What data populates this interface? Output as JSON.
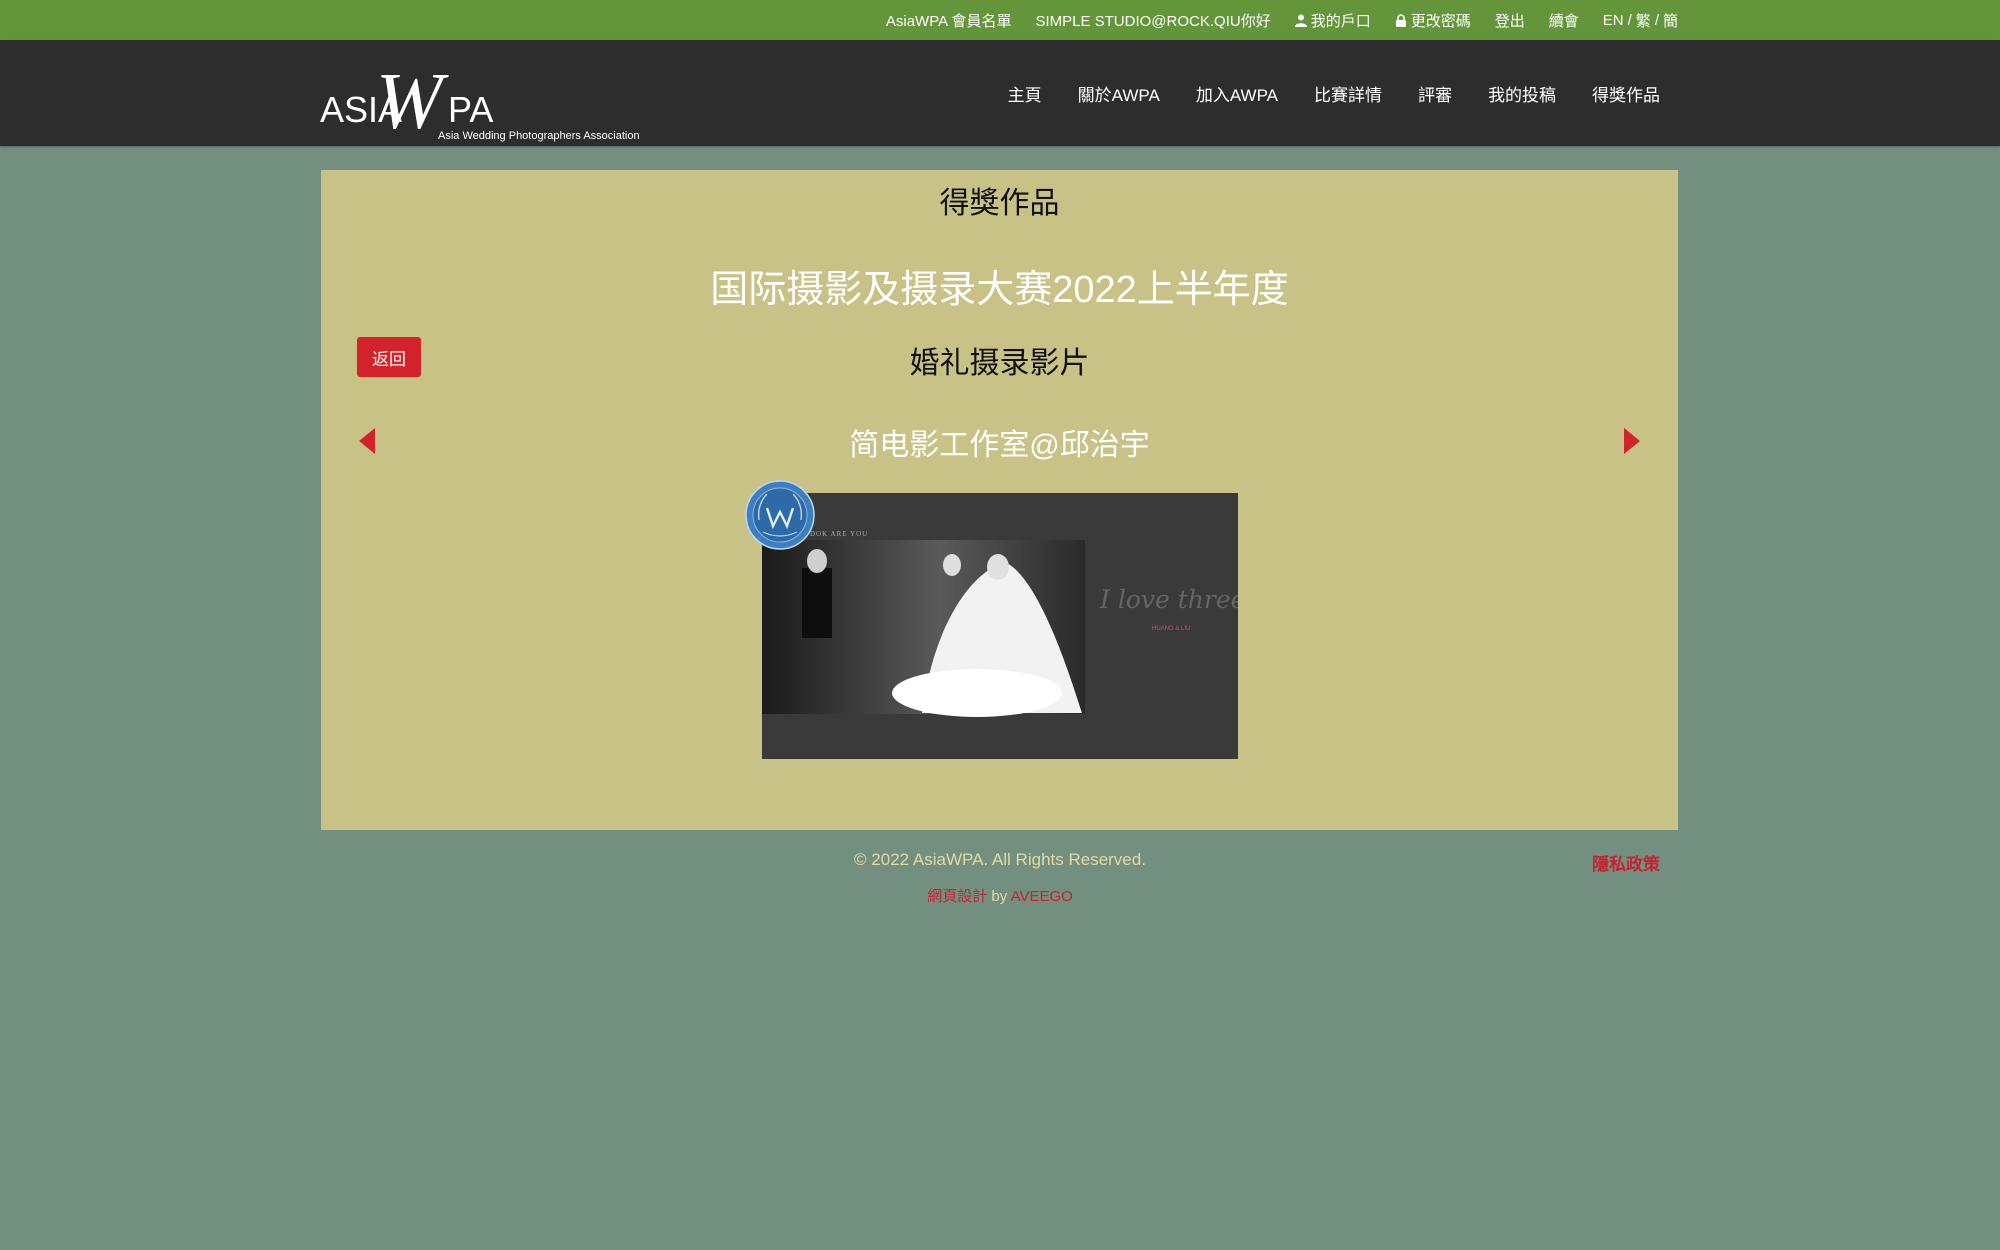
{
  "topbar": {
    "member_list": "AsiaWPA 會員名單",
    "greeting": "SIMPLE STUDIO@ROCK.QIU你好",
    "my_account": "我的戶口",
    "change_password": "更改密碼",
    "logout": "登出",
    "renew": "續會",
    "lang_en": "EN",
    "lang_trad": "繁",
    "lang_simp": "簡",
    "lang_sep": "/"
  },
  "nav": {
    "items": [
      "主頁",
      "關於AWPA",
      "加入AWPA",
      "比賽詳情",
      "評審",
      "我的投稿",
      "得獎作品"
    ]
  },
  "logo": {
    "main": "ASIA",
    "w": "W",
    "pa": "PA",
    "subtitle": "Asia Wedding Photographers Association"
  },
  "main": {
    "heading": "得獎作品",
    "contest_title": "国际摄影及摄录大赛2022上半年度",
    "back_label": "返回",
    "category": "婚礼摄录影片",
    "author": "简电影工作室@邱治宇"
  },
  "thumbnail": {
    "top_text": "DOK ARE YOU",
    "script_text": "I love three things in this world.",
    "names": "HUANG & LIU"
  },
  "footer": {
    "copyright": "© 2022 AsiaWPA. All Rights Reserved.",
    "privacy": "隱私政策",
    "design_label": "網頁設計",
    "by": "by",
    "designer": "AVEEGO"
  },
  "colors": {
    "topbar": "#64953a",
    "navbar": "#2d2d2d",
    "background": "#728f80",
    "panel": "#c8c287",
    "accent_red": "#d3232a"
  }
}
